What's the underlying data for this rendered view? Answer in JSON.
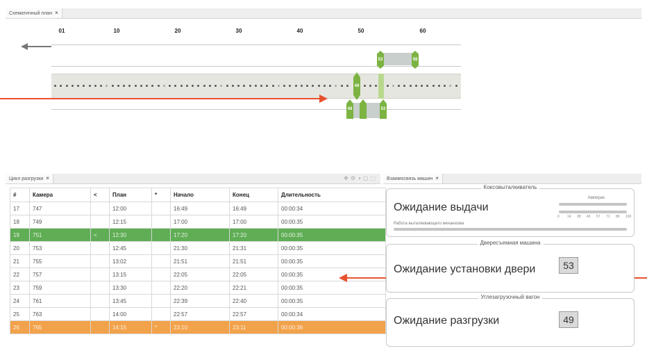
{
  "schematic": {
    "tab_label": "Схематичный план",
    "ruler": [
      "01",
      "10",
      "20",
      "30",
      "40",
      "50",
      "60"
    ],
    "markers": {
      "top_left": "53",
      "top_right": "58",
      "mid": "49",
      "bottom_a": "48",
      "bottom_c": "53"
    }
  },
  "cycle": {
    "tab_label": "Цикл разгрузки",
    "columns": [
      "#",
      "Камера",
      "<",
      "План",
      "*",
      "Начало",
      "Конец",
      "Длительность"
    ],
    "rows": [
      [
        "17",
        "747",
        "",
        "12:00",
        "",
        "16:49",
        "16:49",
        "00:00:34"
      ],
      [
        "18",
        "749",
        "",
        "12:15",
        "",
        "17:00",
        "17:00",
        "00:00:35"
      ],
      [
        "19",
        "751",
        "<",
        "12:30",
        "",
        "17:20",
        "17:20",
        "00:00:35"
      ],
      [
        "20",
        "753",
        "",
        "12:45",
        "",
        "21:30",
        "21:31",
        "00:00:35"
      ],
      [
        "21",
        "755",
        "",
        "13:02",
        "",
        "21:51",
        "21:51",
        "00:00:35"
      ],
      [
        "22",
        "757",
        "",
        "13:15",
        "",
        "22:05",
        "22:05",
        "00:00:35"
      ],
      [
        "23",
        "759",
        "",
        "13:30",
        "",
        "22:20",
        "22:21",
        "00:00:35"
      ],
      [
        "24",
        "761",
        "",
        "13:45",
        "",
        "22:39",
        "22:40",
        "00:00:35"
      ],
      [
        "25",
        "763",
        "",
        "14:00",
        "",
        "22:57",
        "22:57",
        "00:00:34"
      ],
      [
        "26",
        "765",
        "",
        "14:15",
        "*",
        "23:10",
        "23:11",
        "00:00:36"
      ]
    ]
  },
  "machines": {
    "tab_label": "Взаимосвязь машин",
    "coke": {
      "title": "Коксовыталкиватель",
      "status": "Ожидание выдачи",
      "sub": "Работа выталкивающего механизма",
      "ammeter": "Амперах",
      "scale": [
        "0",
        "14",
        "28",
        "43",
        "57",
        "71",
        "86",
        "100"
      ]
    },
    "door": {
      "title": "Двересъемная машина",
      "status": "Ожидание установки двери",
      "number": "53"
    },
    "wagon": {
      "title": "Углезагрузочный вагон",
      "status": "Ожидание разгрузки",
      "number": "49"
    }
  },
  "colors": {
    "accent_green": "#7cb342",
    "row_green": "#5fad55",
    "row_orange": "#f2a24a",
    "annotation_red": "#e8512e"
  }
}
